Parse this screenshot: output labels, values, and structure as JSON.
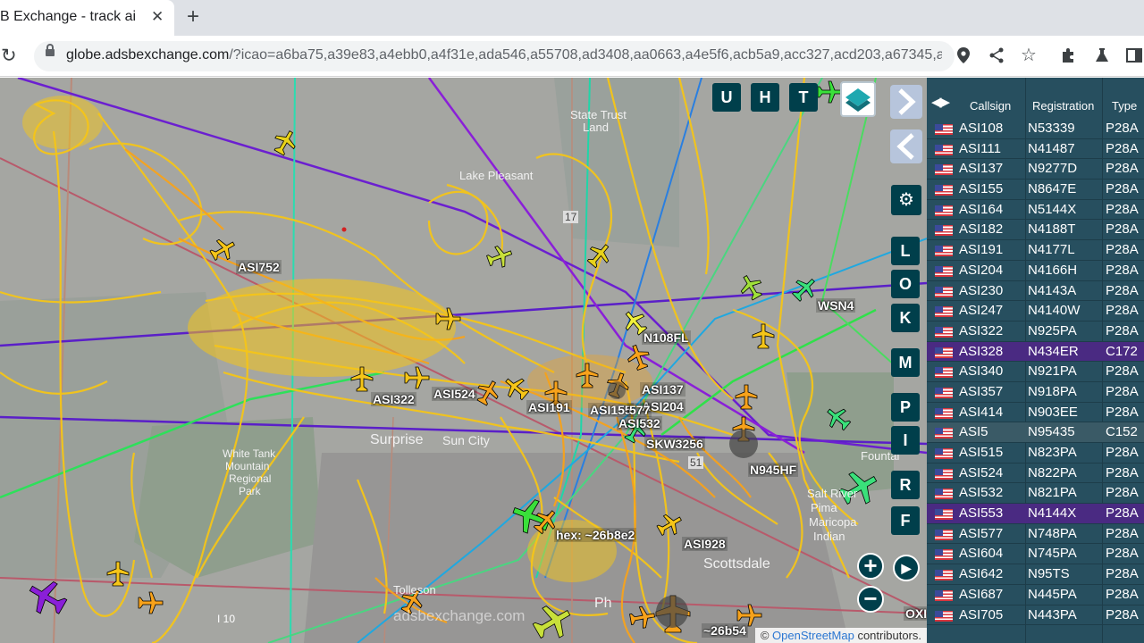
{
  "browser": {
    "tab_title": "B Exchange - track ai",
    "close_label": "✕",
    "new_tab_label": "+",
    "url_host": "globe.adsbexchange.com",
    "url_path": "/?icao=a6ba75,a39e83,a4ebb0,a4f31e,ada546,a55708,ad3408,aa0663,a4e5f6,acb5a9,acc327,acd203,a67345,a..."
  },
  "map": {
    "place_labels": {
      "state_trust": "State Trust",
      "land": "Land",
      "lake_pleasant": "Lake Pleasant",
      "white_tank": "White Tank",
      "mountain": "Mountain",
      "regional": "Regional",
      "park": "Park",
      "surprise": "Surprise",
      "sun_city": "Sun City",
      "scottsdale": "Scottsdale",
      "tolleson": "Tolleson",
      "fountain": "Fountai",
      "salt_river": "Salt River",
      "pima": "Pima",
      "maricopa": "Maricopa",
      "indian": "Indian",
      "i10": "I 10",
      "r17": "17",
      "r51": "51",
      "phx": "Ph"
    },
    "flight_labels": {
      "asi752": "ASI752",
      "wsn4": "WSN4",
      "n108fl": "N108FL",
      "asi322": "ASI322",
      "asi524": "ASI524",
      "asi191": "ASI191",
      "asi137": "ASI137",
      "asi204": "ASI204",
      "asi155": "ASI155",
      "asi577": "577",
      "asi532": "ASI532",
      "skw3256": "SKW3256",
      "n945hf": "N945HF",
      "hex": "hex: ~26b8e2",
      "asi928": "ASI928",
      "hex2": "~26b54",
      "oxi": "OXI"
    },
    "watermark": "adsbexchange.com",
    "attribution_prefix": "©",
    "attribution_link": "OpenStreetMap",
    "attribution_suffix": "contributors."
  },
  "controls": {
    "u": "U",
    "h": "H",
    "t": "T",
    "l": "L",
    "o": "O",
    "k": "K",
    "m": "M",
    "p": "P",
    "i": "I",
    "r": "R",
    "f": "F",
    "zoom_in": "+",
    "zoom_out": "−"
  },
  "table": {
    "headers": {
      "callsign": "Callsign",
      "registration": "Registration",
      "type": "Type"
    },
    "rows": [
      {
        "callsign": "ASI108",
        "reg": "N53339",
        "type": "P28A"
      },
      {
        "callsign": "ASI111",
        "reg": "N41487",
        "type": "P28A"
      },
      {
        "callsign": "ASI137",
        "reg": "N9277D",
        "type": "P28A"
      },
      {
        "callsign": "ASI155",
        "reg": "N8647E",
        "type": "P28A"
      },
      {
        "callsign": "ASI164",
        "reg": "N5144X",
        "type": "P28A"
      },
      {
        "callsign": "ASI182",
        "reg": "N4188T",
        "type": "P28A"
      },
      {
        "callsign": "ASI191",
        "reg": "N4177L",
        "type": "P28A"
      },
      {
        "callsign": "ASI204",
        "reg": "N4166H",
        "type": "P28A"
      },
      {
        "callsign": "ASI230",
        "reg": "N4143A",
        "type": "P28A"
      },
      {
        "callsign": "ASI247",
        "reg": "N4140W",
        "type": "P28A"
      },
      {
        "callsign": "ASI322",
        "reg": "N925PA",
        "type": "P28A"
      },
      {
        "callsign": "ASI328",
        "reg": "N434ER",
        "type": "C172"
      },
      {
        "callsign": "ASI340",
        "reg": "N921PA",
        "type": "P28A"
      },
      {
        "callsign": "ASI357",
        "reg": "N918PA",
        "type": "P28A"
      },
      {
        "callsign": "ASI414",
        "reg": "N903EE",
        "type": "P28A"
      },
      {
        "callsign": "ASI5",
        "reg": "N95435",
        "type": "C152"
      },
      {
        "callsign": "ASI515",
        "reg": "N823PA",
        "type": "P28A"
      },
      {
        "callsign": "ASI524",
        "reg": "N822PA",
        "type": "P28A"
      },
      {
        "callsign": "ASI532",
        "reg": "N821PA",
        "type": "P28A"
      },
      {
        "callsign": "ASI553",
        "reg": "N4144X",
        "type": "P28A"
      },
      {
        "callsign": "ASI577",
        "reg": "N748PA",
        "type": "P28A"
      },
      {
        "callsign": "ASI604",
        "reg": "N745PA",
        "type": "P28A"
      },
      {
        "callsign": "ASI642",
        "reg": "N95TS",
        "type": "P28A"
      },
      {
        "callsign": "ASI687",
        "reg": "N445PA",
        "type": "P28A"
      },
      {
        "callsign": "ASI705",
        "reg": "N443PA",
        "type": "P28A"
      }
    ]
  }
}
